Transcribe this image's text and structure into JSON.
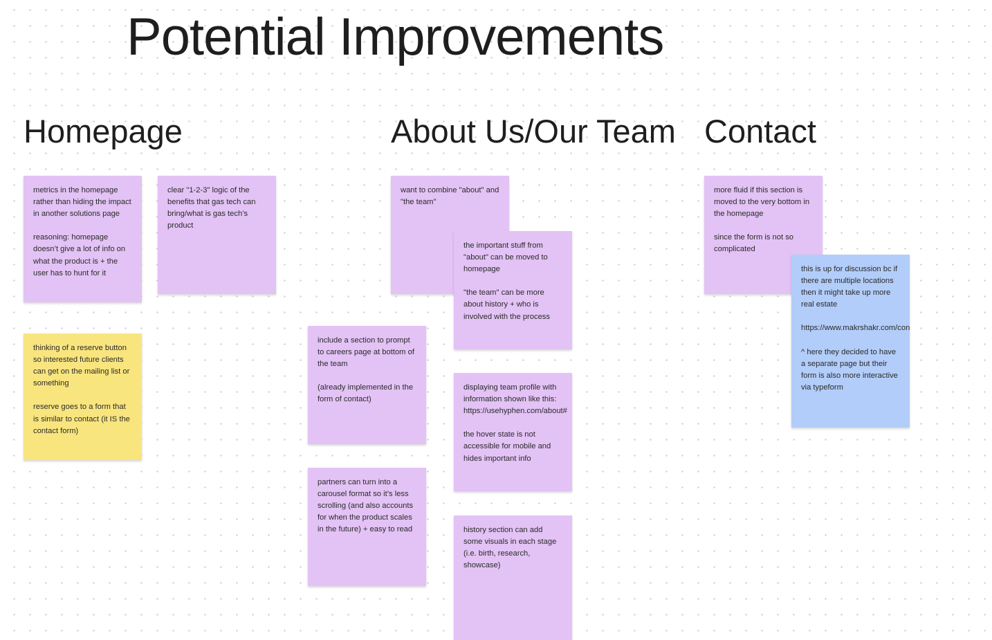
{
  "board": {
    "title": "Potential Improvements",
    "colors": {
      "purple_sticky": "#e3c2f5",
      "yellow_sticky": "#f9e57e",
      "blue_sticky": "#b2cdf9",
      "background": "#ffffff",
      "dot_grid": "#c9c9c9"
    }
  },
  "sections": {
    "homepage": {
      "heading": "Homepage",
      "notes": [
        "metrics in the homepage rather than hiding the impact in another solutions page\n\nreasoning: homepage doesn’t give a lot of info on what the product is + the user has to hunt for it",
        "clear \"1-2-3\" logic of the benefits that gas tech can bring/what is gas tech’s product",
        "thinking of a reserve button so interested future clients can get on the mailing list or something\n\nreserve goes to a form that is similar to contact (it IS the contact form)"
      ]
    },
    "about": {
      "heading": "About Us/Our Team",
      "notes": [
        "want to combine \"about\" and \"the team\"",
        "the important stuff from \"about\" can be moved to homepage\n\n\"the team\" can be more about history + who is involved with the process",
        "include a section to prompt to careers page at bottom of the team\n\n(already implemented in the form of contact)",
        "displaying team profile with information shown like this: https://usehyphen.com/about#\n\nthe hover state is not accessible for mobile and hides important info",
        "partners can turn into a carousel format so it’s less scrolling (and also accounts for when the product scales in the future) + easy to read",
        "history section can add some visuals in each stage (i.e. birth, research, showcase)"
      ]
    },
    "contact": {
      "heading": "Contact",
      "notes": [
        "more fluid if this section is moved to the very bottom in the homepage\n\nsince the form is not so complicated",
        "this is up for discussion bc if there are multiple locations then it might take up more real estate\n\nhttps://www.makrshakr.com/contact/\n\n^ here they decided to have a separate page but their form is also more interactive via typeform"
      ]
    }
  }
}
